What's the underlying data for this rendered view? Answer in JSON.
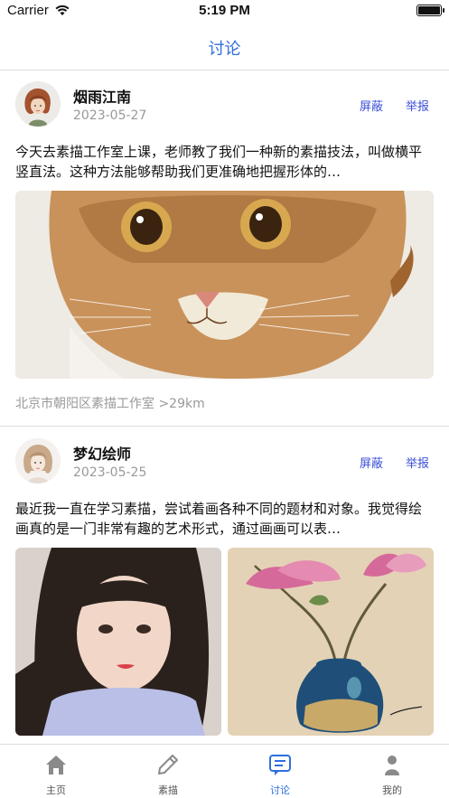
{
  "status_bar": {
    "carrier": "Carrier",
    "time": "5:19 PM",
    "battery_level": 1.0
  },
  "nav": {
    "title": "讨论"
  },
  "posts": [
    {
      "username": "烟雨江南",
      "date": "2023-05-27",
      "block_label": "屏蔽",
      "report_label": "举报",
      "text": "今天去素描工作室上课，老师教了我们一种新的素描技法，叫做横平竖直法。这种方法能够帮助我们更准确地把握形体的…",
      "location": "北京市朝阳区素描工作室 >29km"
    },
    {
      "username": "梦幻绘师",
      "date": "2023-05-25",
      "block_label": "屏蔽",
      "report_label": "举报",
      "text": "最近我一直在学习素描，尝试着画各种不同的题材和对象。我觉得绘画真的是一门非常有趣的艺术形式，通过画画可以表…"
    }
  ],
  "tabs": [
    {
      "label": "主页",
      "icon": "home-icon",
      "active": false
    },
    {
      "label": "素描",
      "icon": "pencil-icon",
      "active": false
    },
    {
      "label": "讨论",
      "icon": "chat-icon",
      "active": true
    },
    {
      "label": "我的",
      "icon": "person-icon",
      "active": false
    }
  ],
  "colors": {
    "accent": "#2f6fde",
    "action": "#3b4fd6",
    "muted": "#999999"
  }
}
